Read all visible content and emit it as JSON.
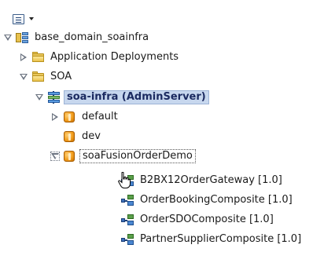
{
  "toolbar": {
    "view_menu_icon": "list-view-icon",
    "dropdown_icon": "caret-down-icon"
  },
  "tree": {
    "domain": {
      "label": "base_domain_soainfra",
      "icon": "domain-icon",
      "expanded": true
    },
    "app_deployments": {
      "label": "Application Deployments",
      "icon": "folder-icon",
      "expanded": false
    },
    "soa_folder": {
      "label": "SOA",
      "icon": "folder-icon",
      "expanded": true
    },
    "soa_infra": {
      "label": "soa-infra (AdminServer)",
      "icon": "server-icon",
      "expanded": true,
      "selected": true
    },
    "partitions": [
      {
        "label": "default",
        "icon": "partition-icon",
        "expanded": false
      },
      {
        "label": "dev",
        "icon": "partition-icon",
        "expanded": null
      },
      {
        "label": "soaFusionOrderDemo",
        "icon": "partition-icon",
        "expanded": true,
        "focused": true
      }
    ],
    "composites": [
      {
        "label": "B2BX12OrderGateway [1.0]",
        "icon": "composite-icon"
      },
      {
        "label": "OrderBookingComposite [1.0]",
        "icon": "composite-icon"
      },
      {
        "label": "OrderSDOComposite [1.0]",
        "icon": "composite-icon"
      },
      {
        "label": "PartnerSupplierComposite [1.0]",
        "icon": "composite-icon"
      }
    ]
  },
  "colors": {
    "selection_bg": "#c7d7ee",
    "selection_text": "#1b2a60",
    "folder": "#e9c65a",
    "partition": "#f09a1a"
  }
}
